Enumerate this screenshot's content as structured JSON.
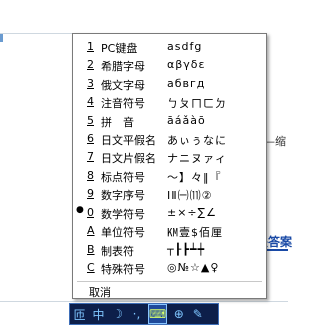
{
  "menu": {
    "items": [
      {
        "key": "1",
        "label": "PC键盘",
        "sample": "asdfg",
        "selected": false
      },
      {
        "key": "2",
        "label": "希腊字母",
        "sample": "αβγδε",
        "selected": false
      },
      {
        "key": "3",
        "label": "俄文字母",
        "sample": "абвгд",
        "selected": false
      },
      {
        "key": "4",
        "label": "注音符号",
        "sample": "ㄅㄆㄇㄈㄉ",
        "selected": false
      },
      {
        "key": "5",
        "label": "拼　音",
        "sample": "āáǎàō",
        "selected": false
      },
      {
        "key": "6",
        "label": "日文平假名",
        "sample": "あぃぅなに",
        "selected": false
      },
      {
        "key": "7",
        "label": "日文片假名",
        "sample": "ナニヌァィ",
        "selected": false
      },
      {
        "key": "8",
        "label": "标点符号",
        "sample": "～】々‖『",
        "selected": false
      },
      {
        "key": "9",
        "label": "数字序号",
        "sample": "ⅠⅡ㈠⑾②",
        "selected": false
      },
      {
        "key": "0",
        "label": "数学符号",
        "sample": "±×÷∑∠",
        "selected": true
      },
      {
        "key": "A",
        "label": "单位符号",
        "sample": "㏎壹$佰厘",
        "selected": false
      },
      {
        "key": "B",
        "label": "制表符",
        "sample": "┬┠┣┷┿",
        "selected": false
      },
      {
        "key": "C",
        "label": "特殊符号",
        "sample": "◎№☆▲♀",
        "selected": false
      }
    ],
    "cancel_label": "取消",
    "selected_marker": "●"
  },
  "background": {
    "right_text": "缩",
    "link_text": "关答案"
  },
  "toolbar": {
    "buttons": [
      {
        "name": "ime-logo-icon",
        "glyph": "匝"
      },
      {
        "name": "chinese-mode-icon",
        "glyph": "中"
      },
      {
        "name": "half-width-icon",
        "glyph": "☽"
      },
      {
        "name": "punctuation-icon",
        "glyph": "·,"
      },
      {
        "name": "soft-keyboard-icon",
        "glyph": "⌨"
      },
      {
        "name": "tool-icon",
        "glyph": "⊕"
      },
      {
        "name": "settings-icon",
        "glyph": "✎"
      }
    ]
  },
  "colors": {
    "toolbar_bg": "#0d1f4a",
    "toolbar_border": "#3f6fb8",
    "link": "#1a4aa6"
  }
}
